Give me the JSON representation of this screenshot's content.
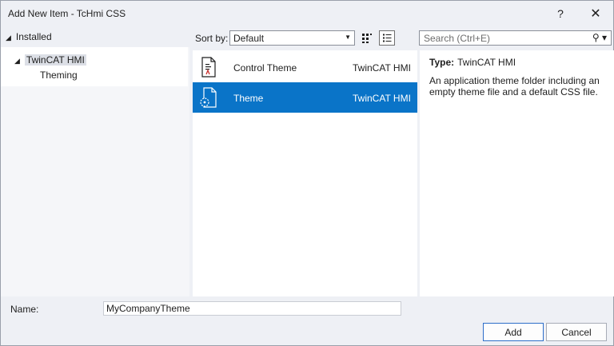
{
  "window": {
    "title": "Add New Item - TcHmi CSS",
    "help_label": "?",
    "close_label": "✕"
  },
  "tree": {
    "header": "Installed",
    "root": "TwinCAT HMI",
    "child": "Theming"
  },
  "sort": {
    "label": "Sort by:",
    "selected": "Default"
  },
  "search": {
    "placeholder": "Search (Ctrl+E)"
  },
  "templates": [
    {
      "name": "Control Theme",
      "type": "TwinCAT HMI",
      "icon": "css-file-icon"
    },
    {
      "name": "Theme",
      "type": "TwinCAT HMI",
      "icon": "theme-folder-icon"
    }
  ],
  "details": {
    "type_label": "Type:",
    "type_value": "TwinCAT HMI",
    "description": "An application theme folder including an empty theme file and a default CSS file."
  },
  "name_field": {
    "label": "Name:",
    "value": "MyCompanyTheme"
  },
  "buttons": {
    "add": "Add",
    "cancel": "Cancel"
  },
  "colors": {
    "selection": "#0a74c8",
    "background": "#eef0f5"
  }
}
